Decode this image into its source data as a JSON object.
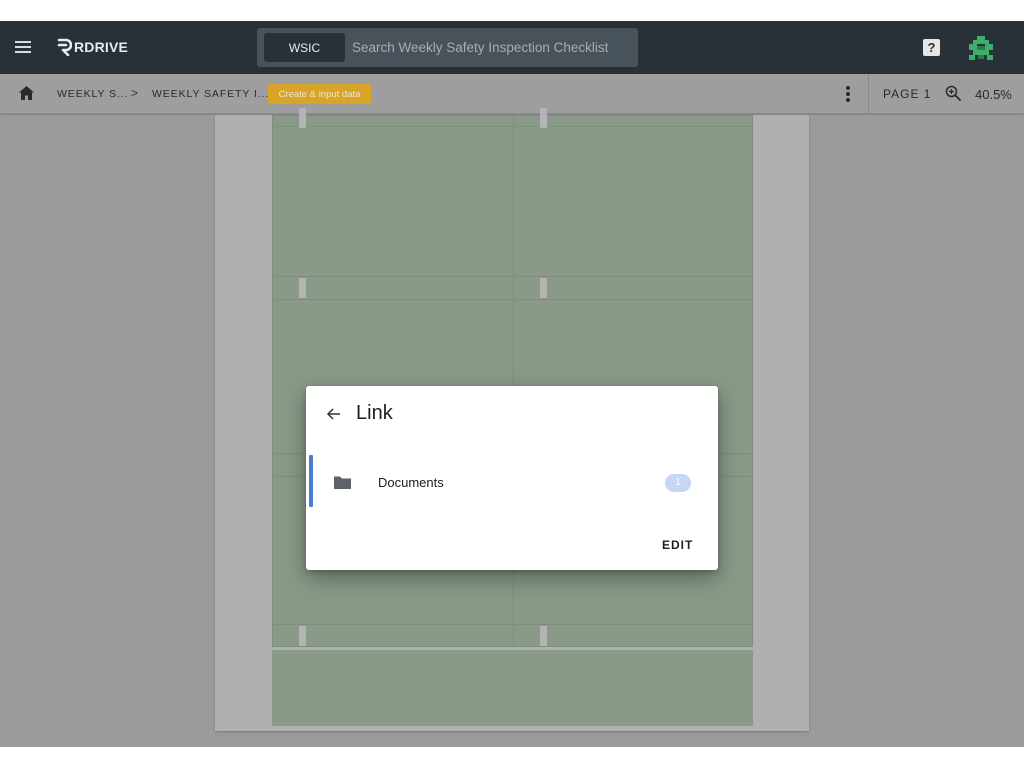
{
  "appbar": {
    "logo_text": "RDRIVE",
    "search": {
      "scope_label": "WSIC",
      "placeholder": "Search Weekly Safety Inspection Checklist"
    },
    "help_label": "?"
  },
  "breadcrumb": {
    "items": [
      {
        "label": "WEEKLY S..."
      },
      {
        "label": "WEEKLY SAFETY I..."
      }
    ],
    "separator": ">",
    "action_label": "Create & input data",
    "page_label": "PAGE 1",
    "zoom_label": "40.5%"
  },
  "dialog": {
    "title": "Link",
    "row": {
      "label": "Documents",
      "count": "1"
    },
    "edit_label": "EDIT"
  },
  "colors": {
    "appbar_bg": "#283038",
    "accent_chip": "#d9a528",
    "selection_indicator": "#4a7fd0",
    "badge_bg": "#c5d7f5"
  }
}
